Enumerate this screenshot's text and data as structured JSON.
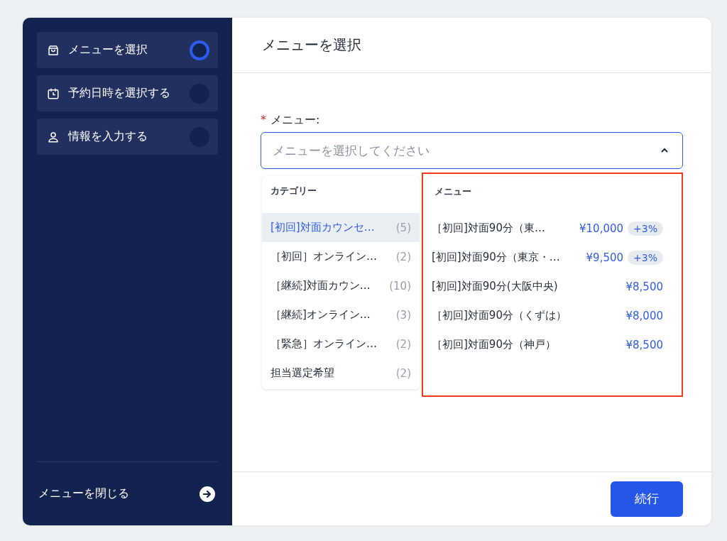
{
  "sidebar": {
    "steps": [
      {
        "label": "メニューを選択",
        "selected": true
      },
      {
        "label": "予約日時を選択する",
        "selected": false
      },
      {
        "label": "情報を入力する",
        "selected": false
      }
    ],
    "close_label": "メニューを閉じる"
  },
  "header": {
    "title": "メニューを選択"
  },
  "field": {
    "label": "メニュー:",
    "required_mark": "*",
    "placeholder": "メニューを選択してください",
    "expanded": true
  },
  "categories": {
    "title": "カテゴリー",
    "items": [
      {
        "name": "[初回]対面カウンセ…",
        "count": "(5)",
        "selected": true
      },
      {
        "name": "［初回］オンライン…",
        "count": "(2)",
        "selected": false
      },
      {
        "name": "［継続]対面カウン…",
        "count": "(10)",
        "selected": false
      },
      {
        "name": "［継続]オンライン…",
        "count": "(3)",
        "selected": false
      },
      {
        "name": "［緊急］オンライン…",
        "count": "(2)",
        "selected": false
      },
      {
        "name": "担当選定希望",
        "count": "(2)",
        "selected": false
      }
    ]
  },
  "menu": {
    "title": "メニュー",
    "items": [
      {
        "name": "［初回]対面90分（東…",
        "price": "¥10,000",
        "badge": "+3%"
      },
      {
        "name": "[初回]対面90分（東京・…",
        "price": "¥9,500",
        "badge": "+3%"
      },
      {
        "name": "[初回]対面90分(大阪中央)",
        "price": "¥8,500"
      },
      {
        "name": "［初回]対面90分（くずは）",
        "price": "¥8,000"
      },
      {
        "name": "［初回]対面90分（神戸）",
        "price": "¥8,500"
      }
    ]
  },
  "continue_button": "続行"
}
